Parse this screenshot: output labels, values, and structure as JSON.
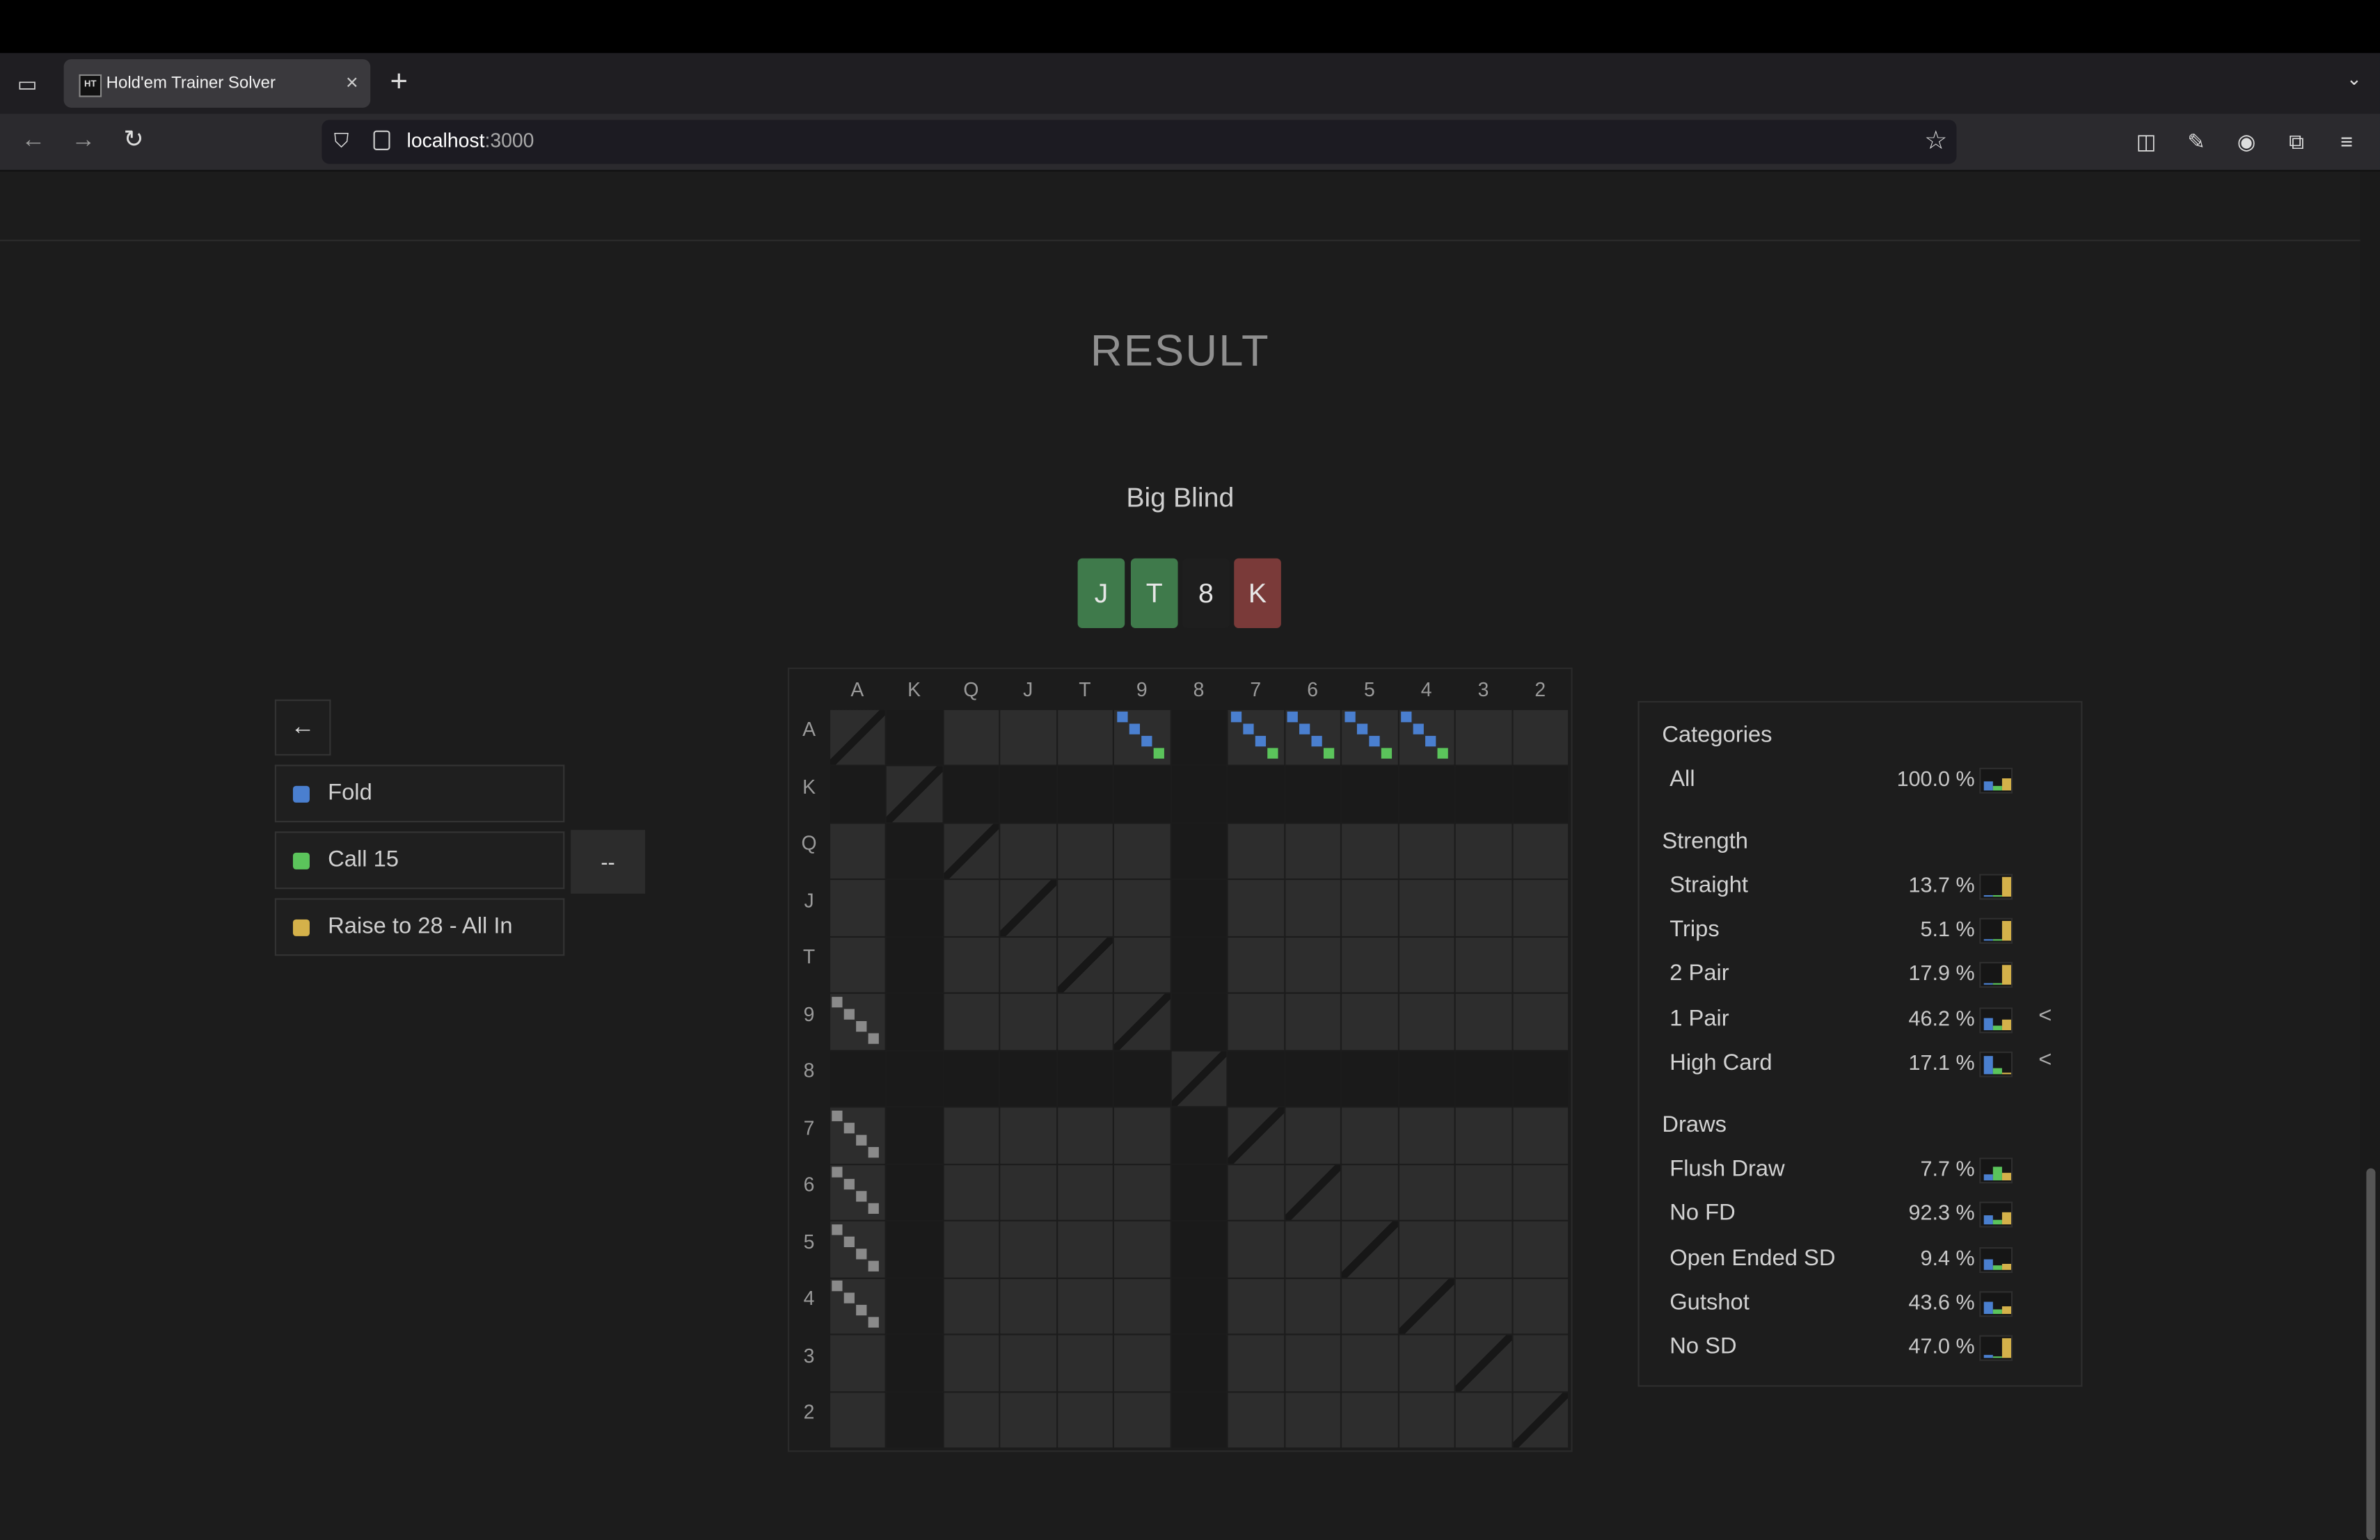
{
  "browser": {
    "tab_title": "Hold'em Trainer Solver",
    "favicon_text": "HT",
    "url_host": "localhost",
    "url_port": ":3000",
    "new_tab": "+",
    "close": "×",
    "tab_menu": "⌄"
  },
  "page": {
    "title": "RESULT",
    "position": "Big Blind",
    "board": [
      {
        "rank": "J",
        "color": "#3f7a4b"
      },
      {
        "rank": "T",
        "color": "#3f7a4b"
      },
      {
        "rank": "8",
        "color": "#1e1e1e"
      },
      {
        "rank": "K",
        "color": "#7a3a39"
      }
    ]
  },
  "actions": {
    "back": "←",
    "items": [
      {
        "label": "Fold",
        "color": "#4a7fcf"
      },
      {
        "label": "Call 15",
        "color": "#5bc45b"
      },
      {
        "label": "Raise to 28 - All In",
        "color": "#d4b14a"
      }
    ],
    "dash_label": "--"
  },
  "grid": {
    "ranks": [
      "A",
      "K",
      "Q",
      "J",
      "T",
      "9",
      "8",
      "7",
      "6",
      "5",
      "4",
      "3",
      "2"
    ],
    "colors": {
      "fold": "#4a7fcf",
      "call": "#5bc45b",
      "raise": "#d4b14a",
      "empty": "#1f1f1f",
      "cell": "#2d2d2d",
      "line": "#141414"
    }
  },
  "categories": {
    "heading": "Categories",
    "all": {
      "name": "All",
      "pct": "100.0 %",
      "mix": [
        0.45,
        0.2,
        0.6
      ]
    },
    "strength_heading": "Strength",
    "strength": [
      {
        "name": "Straight",
        "pct": "13.7 %",
        "arrow": "",
        "mix": [
          0.0,
          0.0,
          1.0
        ]
      },
      {
        "name": "Trips",
        "pct": "5.1 %",
        "arrow": "",
        "mix": [
          0.0,
          0.0,
          1.0
        ]
      },
      {
        "name": "2 Pair",
        "pct": "17.9 %",
        "arrow": "",
        "mix": [
          0.0,
          0.1,
          1.0
        ]
      },
      {
        "name": "1 Pair",
        "pct": "46.2 %",
        "arrow": "<",
        "mix": [
          0.6,
          0.25,
          0.5
        ]
      },
      {
        "name": "High Card",
        "pct": "17.1 %",
        "arrow": "<",
        "mix": [
          0.9,
          0.3,
          0.0
        ]
      }
    ],
    "draws_heading": "Draws",
    "draws": [
      {
        "name": "Flush Draw",
        "pct": "7.7 %",
        "mix": [
          0.3,
          0.7,
          0.4
        ]
      },
      {
        "name": "No FD",
        "pct": "92.3 %",
        "mix": [
          0.45,
          0.2,
          0.6
        ]
      },
      {
        "name": "Open Ended SD",
        "pct": "9.4 %",
        "mix": [
          0.5,
          0.2,
          0.3
        ]
      },
      {
        "name": "Gutshot",
        "pct": "43.6 %",
        "mix": [
          0.6,
          0.2,
          0.35
        ]
      },
      {
        "name": "No SD",
        "pct": "47.0 %",
        "mix": [
          0.15,
          0.05,
          1.0
        ]
      }
    ]
  }
}
